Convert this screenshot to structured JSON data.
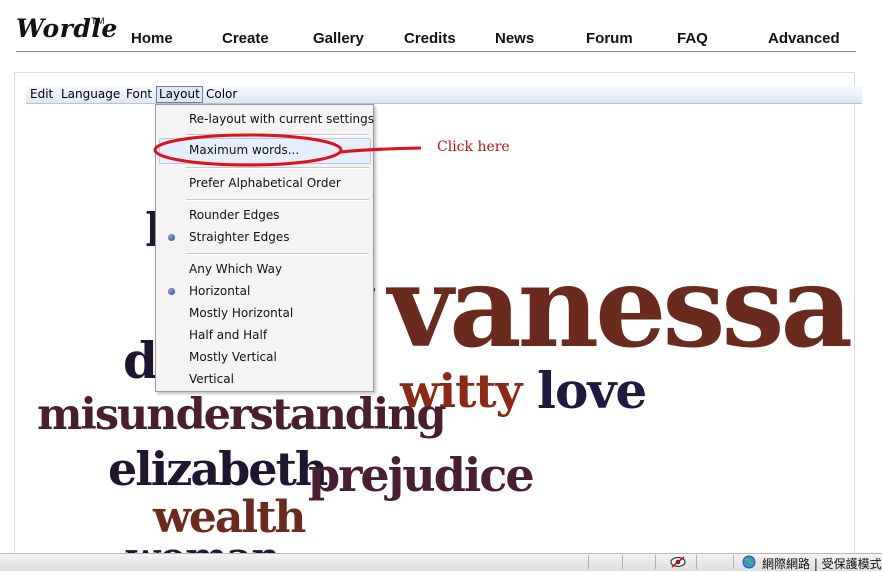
{
  "header": {
    "logo": "Wordle",
    "trademark": "TM",
    "nav": [
      "Home",
      "Create",
      "Gallery",
      "Credits",
      "News",
      "Forum",
      "FAQ",
      "Advanced"
    ]
  },
  "menubar": {
    "items": [
      "Edit",
      "Language",
      "Font",
      "Layout",
      "Color"
    ],
    "active": "Layout"
  },
  "layout_menu": {
    "items": [
      {
        "label": "Re-layout with current settings",
        "checked": false
      },
      {
        "label": "Maximum words...",
        "checked": false,
        "highlighted": true
      },
      {
        "label": "Prefer Alphabetical Order",
        "checked": false
      },
      {
        "label": "Rounder Edges",
        "checked": false
      },
      {
        "label": "Straighter Edges",
        "checked": true
      },
      {
        "label": "Any Which Way",
        "checked": false
      },
      {
        "label": "Horizontal",
        "checked": true
      },
      {
        "label": "Mostly Horizontal",
        "checked": false
      },
      {
        "label": "Half and Half",
        "checked": false
      },
      {
        "label": "Mostly Vertical",
        "checked": false
      },
      {
        "label": "Vertical",
        "checked": false
      }
    ]
  },
  "annotation": {
    "text": "Click here",
    "color": "#c0101a"
  },
  "word_cloud": {
    "words": [
      {
        "text": "vanessa",
        "color": "#6b2a1e"
      },
      {
        "text": "witty",
        "color": "#8a2a14"
      },
      {
        "text": "love",
        "color": "#1e1a40"
      },
      {
        "text": "misunderstanding",
        "color": "#4a1f2c"
      },
      {
        "text": "elizabeth",
        "color": "#1f1530"
      },
      {
        "text": "prejudice",
        "color": "#4a1f34"
      },
      {
        "text": "wealth",
        "color": "#6b2a1e"
      },
      {
        "text": "woman",
        "color": "#1f1530"
      },
      {
        "text": "da",
        "color": "#1f1530"
      },
      {
        "text": "l",
        "color": "#1f1530"
      },
      {
        "text": "t",
        "color": "#1f1530"
      }
    ]
  },
  "statusbar": {
    "zone": "網際網路 | 受保護模式:"
  }
}
